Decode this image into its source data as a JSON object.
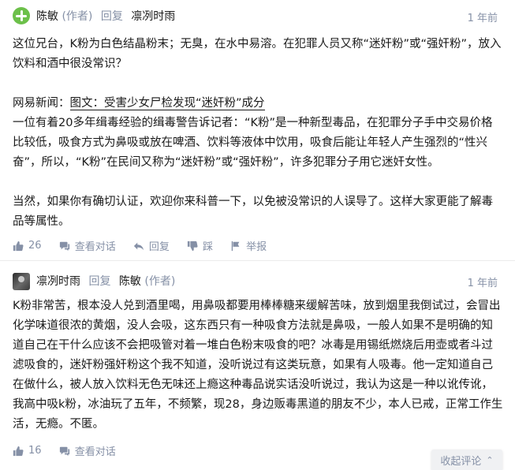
{
  "comments": [
    {
      "author": "陈敏",
      "author_tag": "(作者)",
      "reply_label": "回复",
      "reply_to": "凛冽时雨",
      "reply_to_tag": "",
      "time": "1 年前",
      "paragraphs": [
        "这位兄台，K粉为白色结晶粉末；无臭，在水中易溶。在犯罪人员又称“迷奸粉”或“强奸粉”，放入饮料和酒中很没常识？",
        "",
        "网易新闻：",
        "一位有着20多年缉毒经验的缉毒警告诉记者：“K粉”是一种新型毒品，在犯罪分子手中交易价格比较低，吸食方式为鼻吸或放在啤酒、饮料等液体中饮用，吸食后能让年轻人产生强烈的“性兴奋”，所以，“K粉”在民间又称为“迷奸粉”或“强奸粉”，许多犯罪分子用它迷奸女性。",
        "",
        "当然，如果你有确切认证，欢迎你来科普一下，以免被没常识的人误导了。这样大家更能了解毒品等属性。"
      ],
      "news_link": "图文：受害少女尸检发现“迷奸粉”成分",
      "likes": "26",
      "action_conversation": "查看对话",
      "action_reply": "回复",
      "action_dislike": "踩",
      "action_report": "举报"
    },
    {
      "author": "凛冽时雨",
      "author_tag": "",
      "reply_label": "回复",
      "reply_to": "陈敏",
      "reply_to_tag": "(作者)",
      "time": "1 年前",
      "paragraphs": [
        "K粉非常苦，根本没人兑到酒里喝，用鼻吸都要用棒棒糖来缓解苦味，放到烟里我倒试过，会冒出化学味道很浓的黄烟，没人会吸，这东西只有一种吸食方法就是鼻吸，一般人如果不是明确的知道自己在干什么应该不会把吸管对着一堆白色粉末吸食的吧？冰毒是用锡纸燃烧后用壶或者斗过滤吸食的，迷奸粉强奸粉这个我不知道，没听说过有这类玩意，如果有人吸毒。他一定知道自己在做什么，被人放入饮料无色无味还上瘾这种毒品说实话没听说过，我认为这是一种以讹传讹，我高中吸k粉，冰油玩了五年，不频繁，现28，身边贩毒黑道的朋友不少，本人已戒，正常工作生活，无瘾。不匿。"
      ],
      "likes": "16",
      "action_conversation": "查看对话"
    }
  ],
  "collapse_label": "收起评论",
  "colors": {
    "muted": "#8590a6",
    "avatar_green": "#6cc04a"
  }
}
